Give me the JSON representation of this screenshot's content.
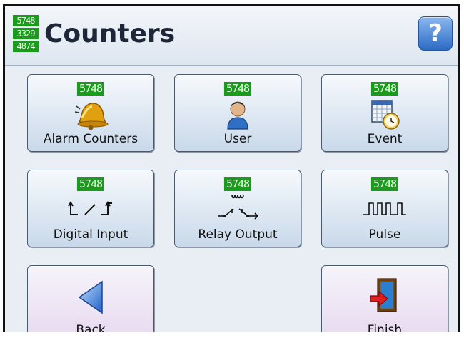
{
  "header": {
    "title": "Counters",
    "logo_lines": [
      "5748",
      "3329",
      "4874"
    ],
    "help_label": "?"
  },
  "buttons": {
    "alarm_counters": {
      "label": "Alarm Counters",
      "counter": "5748",
      "icon": "bell-icon"
    },
    "user": {
      "label": "User",
      "counter": "5748",
      "icon": "user-icon"
    },
    "event": {
      "label": "Event",
      "counter": "5748",
      "icon": "calendar-clock-icon"
    },
    "digital_input": {
      "label": "Digital Input",
      "counter": "5748",
      "icon": "digital-input-icon"
    },
    "relay_output": {
      "label": "Relay Output",
      "counter": "5748",
      "icon": "relay-icon"
    },
    "pulse": {
      "label": "Pulse",
      "counter": "5748",
      "icon": "pulse-icon"
    },
    "back": {
      "label": "Back",
      "icon": "back-arrow-icon"
    },
    "finish": {
      "label": "Finish",
      "icon": "exit-door-icon"
    }
  },
  "colors": {
    "counter_bg": "#1b9b1b",
    "button_blue_bottom": "#c9d9ea",
    "button_pink_bottom": "#e6d8ef",
    "background": "#e9eef5"
  }
}
